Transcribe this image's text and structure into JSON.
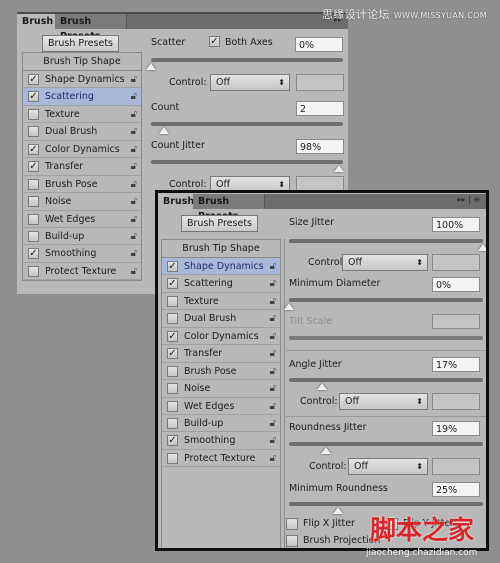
{
  "back_panel": {
    "tabs": [
      "Brush",
      "Brush Presets"
    ],
    "presets_button": "Brush Presets",
    "list_header": "Brush Tip Shape",
    "items": [
      {
        "label": "Shape Dynamics",
        "checked": true
      },
      {
        "label": "Scattering",
        "checked": true,
        "selected": true
      },
      {
        "label": "Texture",
        "checked": false
      },
      {
        "label": "Dual Brush",
        "checked": false
      },
      {
        "label": "Color Dynamics",
        "checked": true
      },
      {
        "label": "Transfer",
        "checked": true
      },
      {
        "label": "Brush Pose",
        "checked": false
      },
      {
        "label": "Noise",
        "checked": false
      },
      {
        "label": "Wet Edges",
        "checked": false
      },
      {
        "label": "Build-up",
        "checked": false
      },
      {
        "label": "Smoothing",
        "checked": true
      },
      {
        "label": "Protect Texture",
        "checked": false
      }
    ],
    "scatter": {
      "label": "Scatter",
      "both_axes_label": "Both Axes",
      "both_axes": true,
      "value": "0%",
      "slider_pct": 0
    },
    "control1": {
      "label": "Control:",
      "value": "Off"
    },
    "count": {
      "label": "Count",
      "value": "2",
      "slider_pct": 7
    },
    "count_jitter": {
      "label": "Count Jitter",
      "value": "98%",
      "slider_pct": 98
    },
    "control2": {
      "label": "Control:",
      "value": "Off"
    }
  },
  "front_panel": {
    "tabs": [
      "Brush",
      "Brush Presets"
    ],
    "presets_button": "Brush Presets",
    "list_header": "Brush Tip Shape",
    "items": [
      {
        "label": "Shape Dynamics",
        "checked": true,
        "selected": true
      },
      {
        "label": "Scattering",
        "checked": true
      },
      {
        "label": "Texture",
        "checked": false
      },
      {
        "label": "Dual Brush",
        "checked": false
      },
      {
        "label": "Color Dynamics",
        "checked": true
      },
      {
        "label": "Transfer",
        "checked": true
      },
      {
        "label": "Brush Pose",
        "checked": false
      },
      {
        "label": "Noise",
        "checked": false
      },
      {
        "label": "Wet Edges",
        "checked": false
      },
      {
        "label": "Build-up",
        "checked": false
      },
      {
        "label": "Smoothing",
        "checked": true
      },
      {
        "label": "Protect Texture",
        "checked": false
      }
    ],
    "size_jitter": {
      "label": "Size Jitter",
      "value": "100%",
      "slider_pct": 100
    },
    "control1": {
      "label": "Control:",
      "value": "Off"
    },
    "min_diameter": {
      "label": "Minimum Diameter",
      "value": "0%",
      "slider_pct": 0
    },
    "tilt_scale": {
      "label": "Tilt Scale",
      "disabled": true
    },
    "angle_jitter": {
      "label": "Angle Jitter",
      "value": "17%",
      "slider_pct": 17
    },
    "control2": {
      "label": "Control:",
      "value": "Off"
    },
    "roundness_jitter": {
      "label": "Roundness Jitter",
      "value": "19%",
      "slider_pct": 19
    },
    "control3": {
      "label": "Control:",
      "value": "Off"
    },
    "min_roundness": {
      "label": "Minimum Roundness",
      "value": "25%",
      "slider_pct": 25
    },
    "flip_x": {
      "label": "Flip X Jitter",
      "checked": false
    },
    "flip_y": {
      "label": "Flip Y Jitter",
      "checked": false
    },
    "brush_projection": {
      "label": "Brush Projection",
      "checked": false
    }
  },
  "watermarks": {
    "top": "思缘设计论坛",
    "top_url": "WWW.MISSYUAN.COM",
    "bottom": "脚本之家",
    "bottom_url": "jiaocheng.chazidian.com"
  }
}
